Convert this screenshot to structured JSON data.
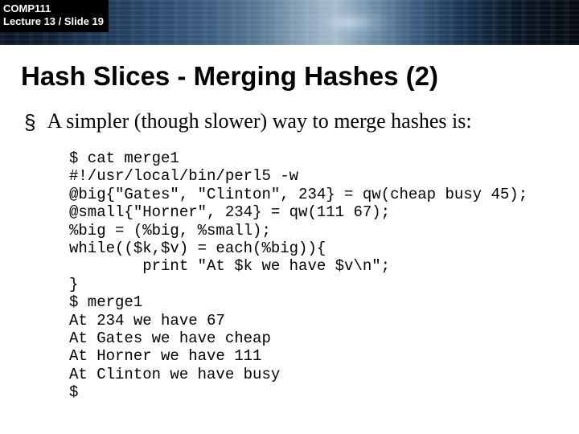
{
  "course": {
    "code": "COMP111",
    "lecture_line": "Lecture 13 / Slide 19"
  },
  "title": "Hash Slices - Merging Hashes (2)",
  "bullet": {
    "marker": "§",
    "text": "A simpler (though slower) way to merge hashes is:"
  },
  "code": "$ cat merge1\n#!/usr/local/bin/perl5 -w\n@big{\"Gates\", \"Clinton\", 234} = qw(cheap busy 45);\n@small{\"Horner\", 234} = qw(111 67);\n%big = (%big, %small);\nwhile(($k,$v) = each(%big)){\n        print \"At $k we have $v\\n\";\n}\n$ merge1\nAt 234 we have 67\nAt Gates we have cheap\nAt Horner we have 111\nAt Clinton we have busy\n$"
}
